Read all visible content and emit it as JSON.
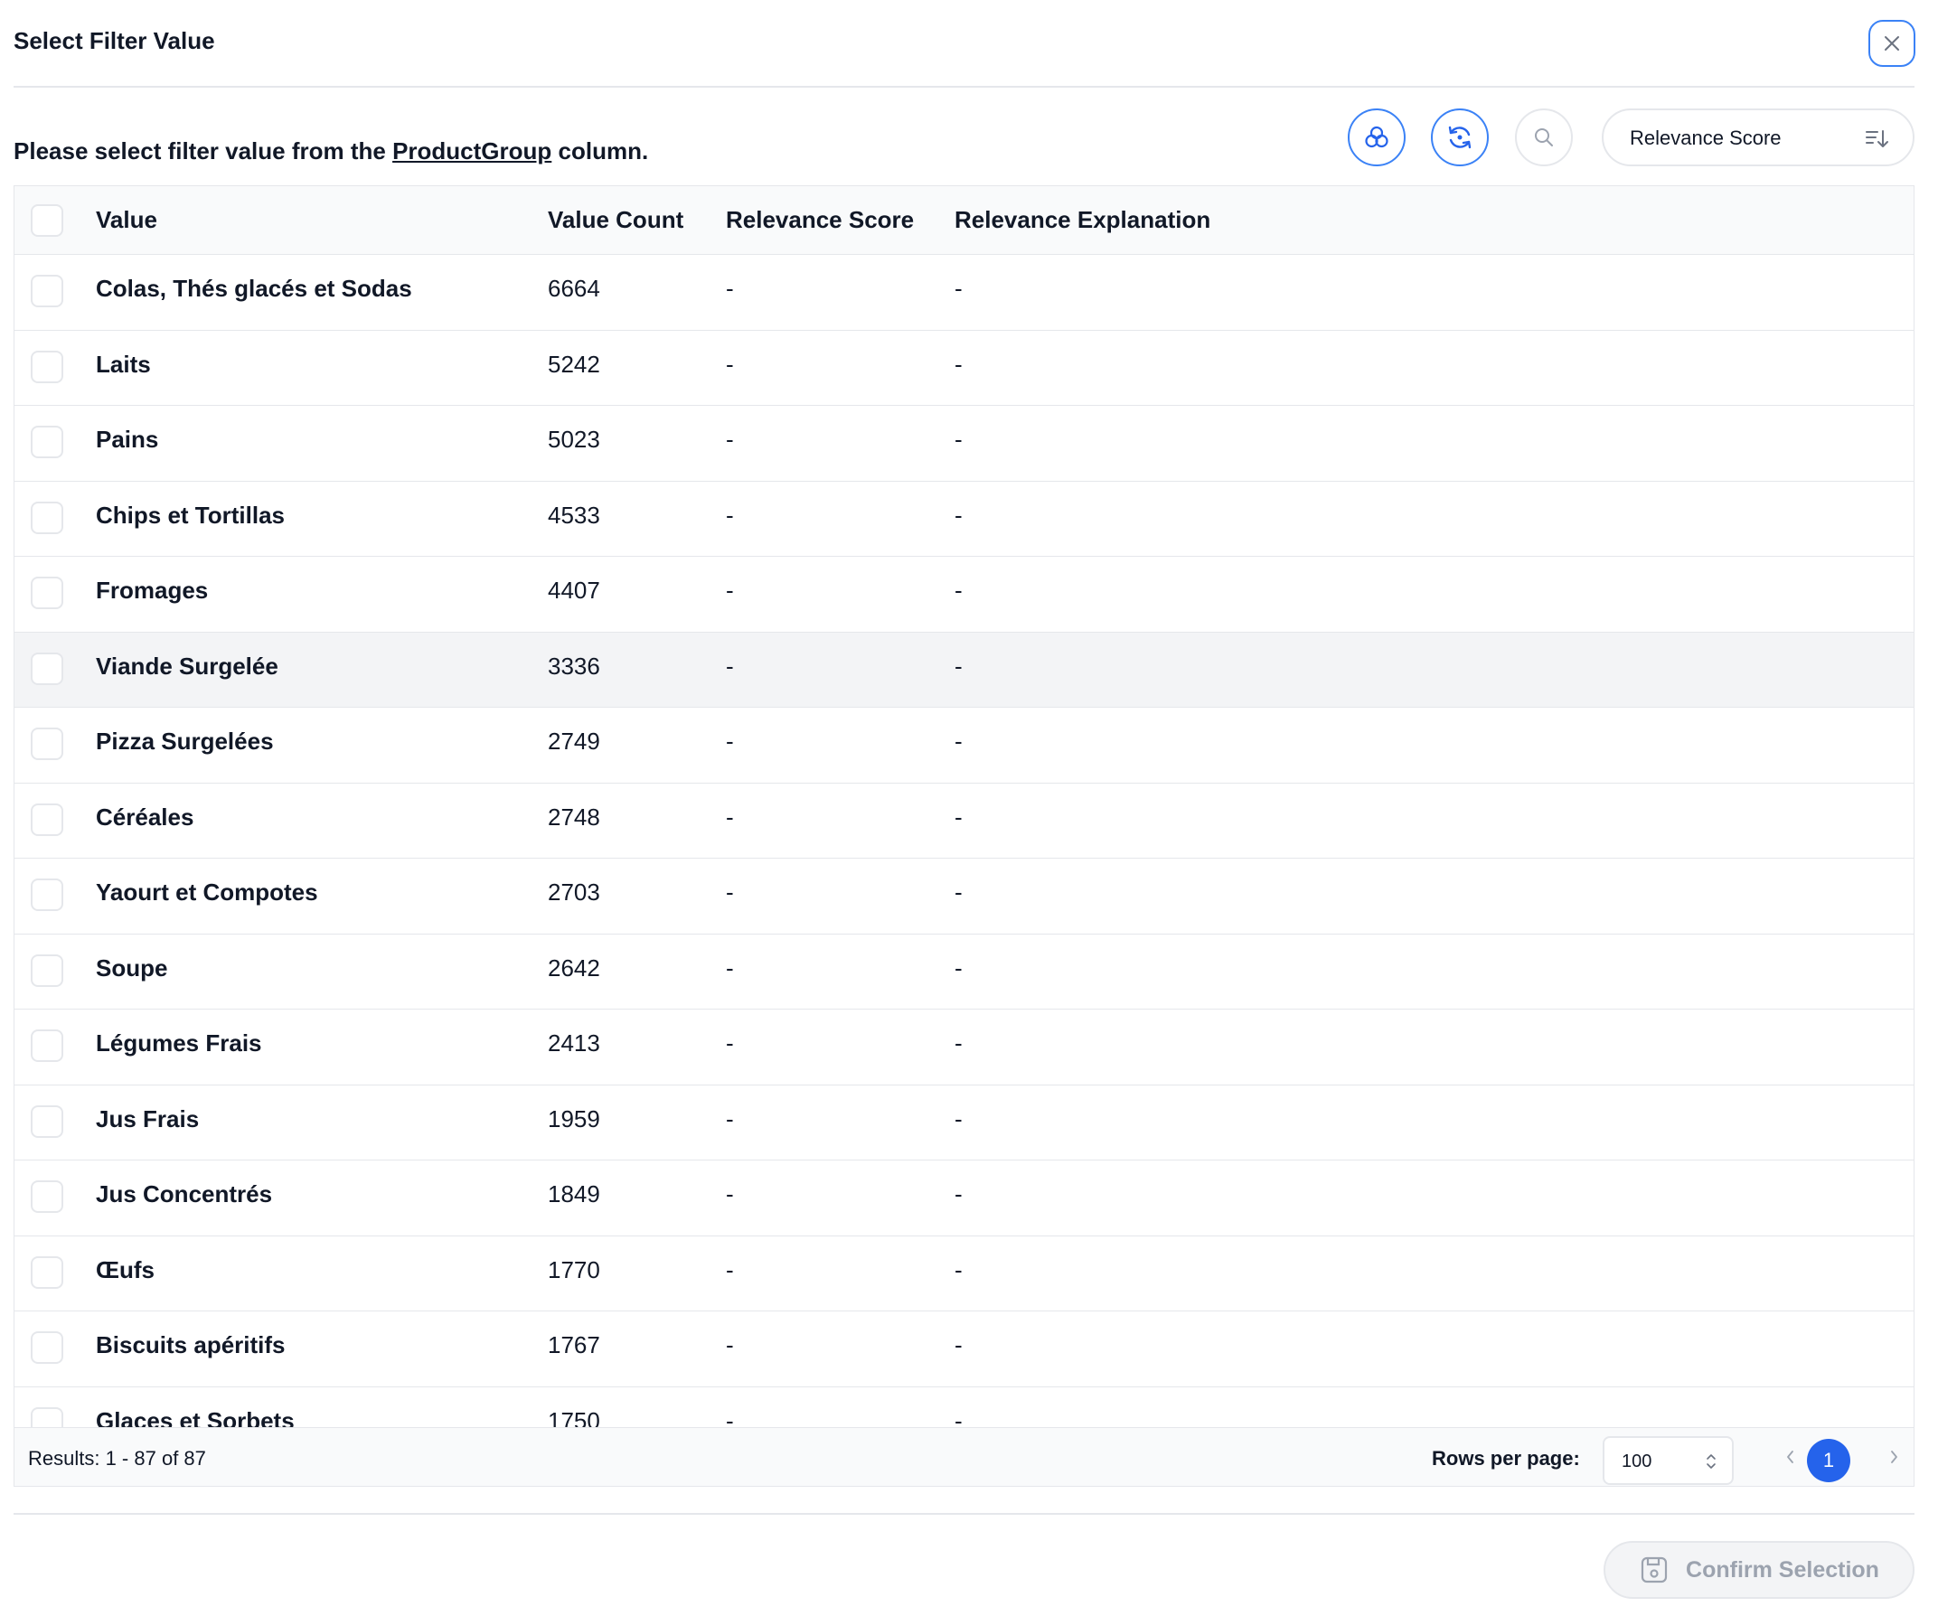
{
  "dialog": {
    "title": "Select Filter Value",
    "instruction": {
      "prefix": "Please select filter value from the ",
      "column": "ProductGroup",
      "suffix": " column."
    }
  },
  "toolbar": {
    "sort_label": "Relevance Score",
    "icons": [
      "ai-cluster-icon",
      "refresh-icon",
      "search-icon",
      "sort-descending-icon"
    ]
  },
  "table": {
    "columns": [
      "Value",
      "Value Count",
      "Relevance Score",
      "Relevance Explanation"
    ],
    "rows": [
      {
        "value": "Colas, Thés glacés et Sodas",
        "count": "6664",
        "score": "-",
        "explanation": "-"
      },
      {
        "value": "Laits",
        "count": "5242",
        "score": "-",
        "explanation": "-"
      },
      {
        "value": "Pains",
        "count": "5023",
        "score": "-",
        "explanation": "-"
      },
      {
        "value": "Chips et Tortillas",
        "count": "4533",
        "score": "-",
        "explanation": "-"
      },
      {
        "value": "Fromages",
        "count": "4407",
        "score": "-",
        "explanation": "-"
      },
      {
        "value": "Viande Surgelée",
        "count": "3336",
        "score": "-",
        "explanation": "-"
      },
      {
        "value": "Pizza Surgelées",
        "count": "2749",
        "score": "-",
        "explanation": "-"
      },
      {
        "value": "Céréales",
        "count": "2748",
        "score": "-",
        "explanation": "-"
      },
      {
        "value": "Yaourt et Compotes",
        "count": "2703",
        "score": "-",
        "explanation": "-"
      },
      {
        "value": "Soupe",
        "count": "2642",
        "score": "-",
        "explanation": "-"
      },
      {
        "value": "Légumes Frais",
        "count": "2413",
        "score": "-",
        "explanation": "-"
      },
      {
        "value": "Jus Frais",
        "count": "1959",
        "score": "-",
        "explanation": "-"
      },
      {
        "value": "Jus Concentrés",
        "count": "1849",
        "score": "-",
        "explanation": "-"
      },
      {
        "value": "Œufs",
        "count": "1770",
        "score": "-",
        "explanation": "-"
      },
      {
        "value": "Biscuits apéritifs",
        "count": "1767",
        "score": "-",
        "explanation": "-"
      },
      {
        "value": "Glaces et Sorbets",
        "count": "1750",
        "score": "-",
        "explanation": "-"
      }
    ]
  },
  "footer": {
    "results": "Results: 1 - 87 of 87",
    "rows_per_page_label": "Rows per page:",
    "rows_per_page": "100",
    "current_page": "1"
  },
  "actions": {
    "confirm_label": "Confirm Selection"
  },
  "colors": {
    "accent": "#2563eb",
    "border": "#e5e7eb",
    "row_highlight": "#f3f4f6",
    "disabled_text": "#9ca3af"
  }
}
